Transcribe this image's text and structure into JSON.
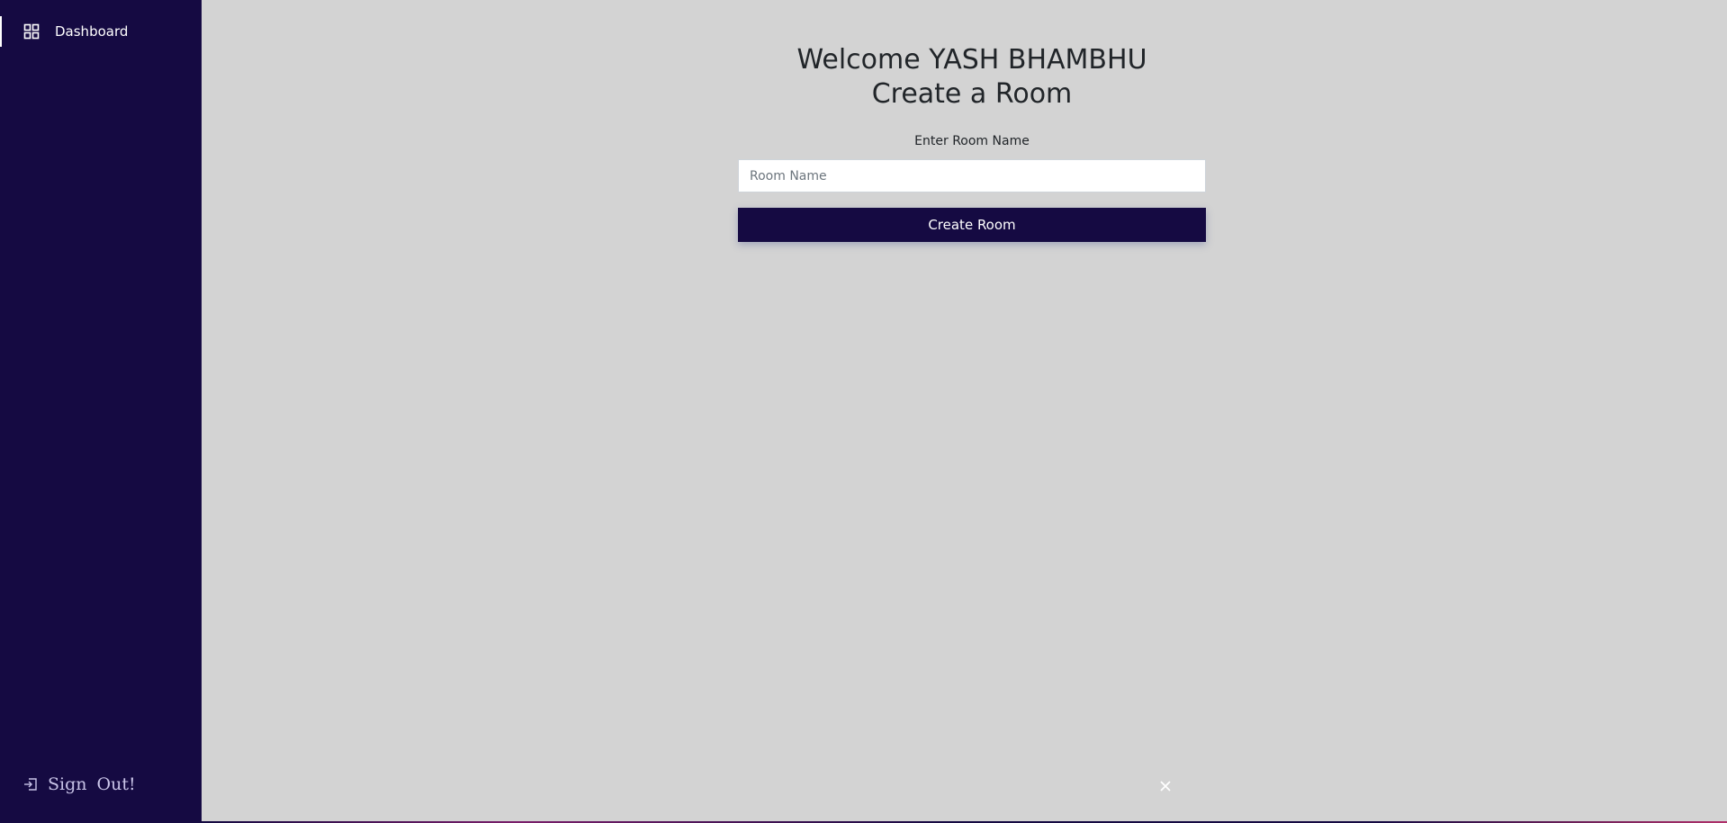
{
  "sidebar": {
    "nav_items": [
      {
        "label": "Dashboard",
        "icon": "grid-icon"
      }
    ],
    "signout_label": "Sign Out!",
    "signout_icon": "sign-out-icon"
  },
  "main": {
    "welcome": "Welcome YASH BHAMBHU",
    "subtitle": "Create a Room",
    "room_label": "Enter Room Name",
    "room_input": {
      "placeholder": "Room Name",
      "value": ""
    },
    "create_button_label": "Create Room",
    "close_icon": "close-icon"
  },
  "colors": {
    "sidebar_bg": "#150a42",
    "main_bg": "#d3d3d3",
    "button_bg": "#150a42",
    "text": "#212529"
  }
}
